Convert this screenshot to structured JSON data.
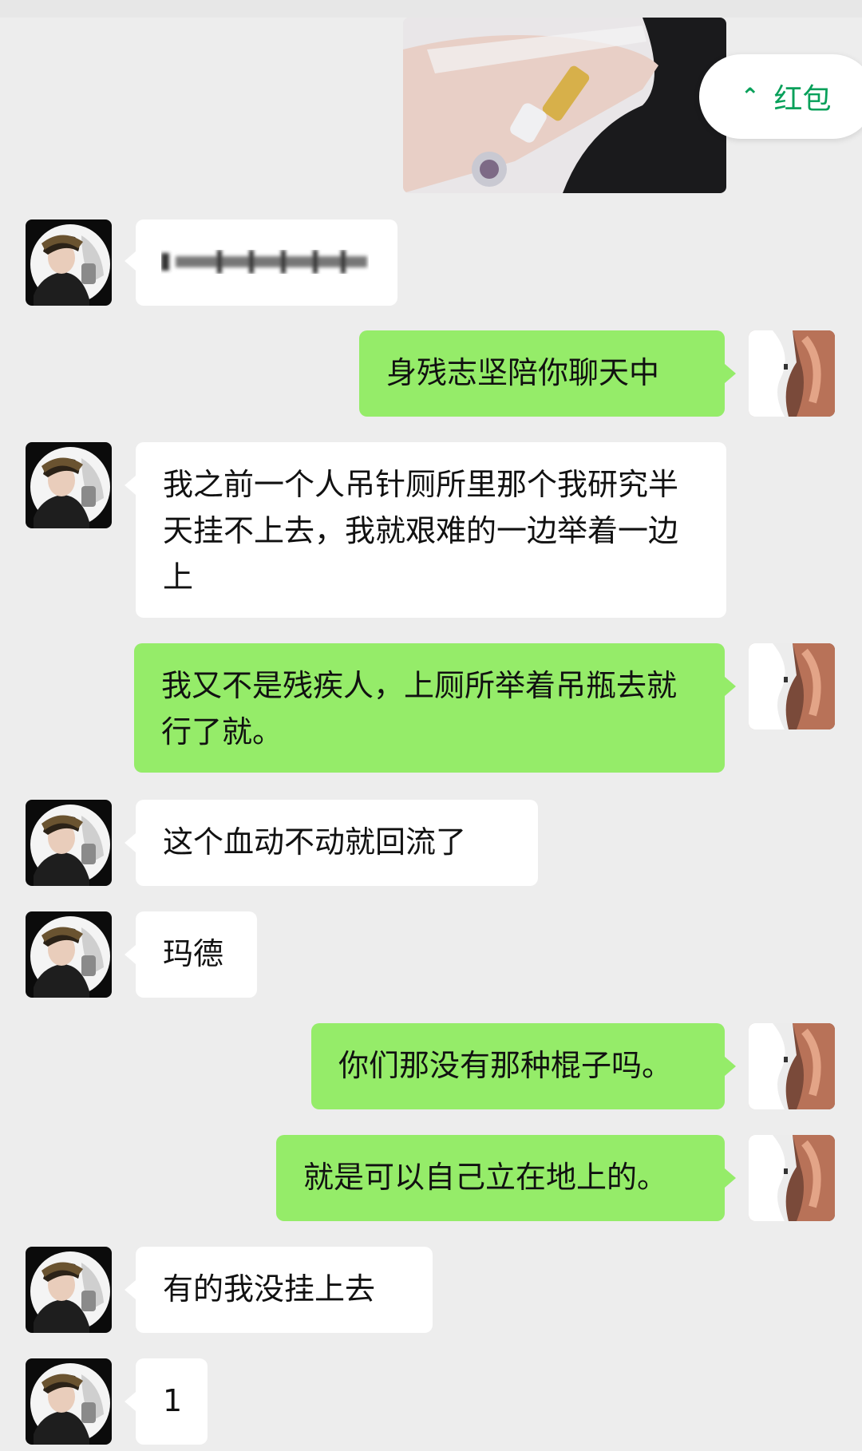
{
  "red_packet": {
    "icon": "double-chevron-up-icon",
    "label": "红包"
  },
  "messages": [
    {
      "from": "other",
      "text": ""
    },
    {
      "from": "me",
      "text": "身残志坚陪你聊天中"
    },
    {
      "from": "other",
      "text": "我之前一个人吊针厕所里那个我研究半天挂不上去，我就艰难的一边举着一边上"
    },
    {
      "from": "me",
      "text": "我又不是残疾人，上厕所举着吊瓶去就行了就。"
    },
    {
      "from": "other",
      "text": "这个血动不动就回流了"
    },
    {
      "from": "other",
      "text": "玛德"
    },
    {
      "from": "me",
      "text": "你们那没有那种棍子吗。"
    },
    {
      "from": "me",
      "text": "就是可以自己立在地上的。"
    },
    {
      "from": "other",
      "text": "有的我没挂上去"
    },
    {
      "from": "other",
      "text": "1"
    }
  ],
  "colors": {
    "bubble_out": "#95ec69",
    "bubble_in": "#ffffff",
    "background": "#ededed",
    "accent": "#07a05a"
  }
}
